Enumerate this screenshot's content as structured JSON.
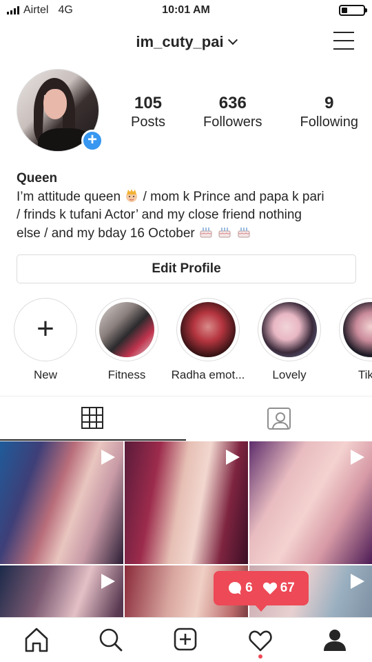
{
  "status_bar": {
    "carrier": "Airtel",
    "network": "4G",
    "time": "10:01 AM",
    "battery_level": 0.2
  },
  "header": {
    "username": "im_cuty_pai",
    "menu_icon": "hamburger-menu-icon",
    "dropdown_icon": "chevron-down-icon"
  },
  "profile": {
    "stats": [
      {
        "value": "105",
        "label": "Posts"
      },
      {
        "value": "636",
        "label": "Followers"
      },
      {
        "value": "9",
        "label": "Following"
      }
    ],
    "name": "Queen",
    "bio_line1_a": "I’m attitude queen",
    "bio_line1_b": "/ mom k Prince and papa k pari",
    "bio_line2": "/ frinds k tufani Actor’ and my close friend nothing",
    "bio_line3": "else / and my bday 16 October",
    "edit_profile_label": "Edit Profile"
  },
  "highlights": [
    {
      "label": "New"
    },
    {
      "label": "Fitness"
    },
    {
      "label": "Radha emot..."
    },
    {
      "label": "Lovely"
    },
    {
      "label": "Tikto"
    }
  ],
  "tabs": [
    {
      "icon": "grid-icon",
      "active": true
    },
    {
      "icon": "tagged-icon",
      "active": false
    }
  ],
  "notification": {
    "comments": "6",
    "likes": "67"
  },
  "colors": {
    "accent_blue": "#3897f0",
    "notification_red": "#ed4956",
    "text": "#262626",
    "border": "#dbdbdb"
  }
}
